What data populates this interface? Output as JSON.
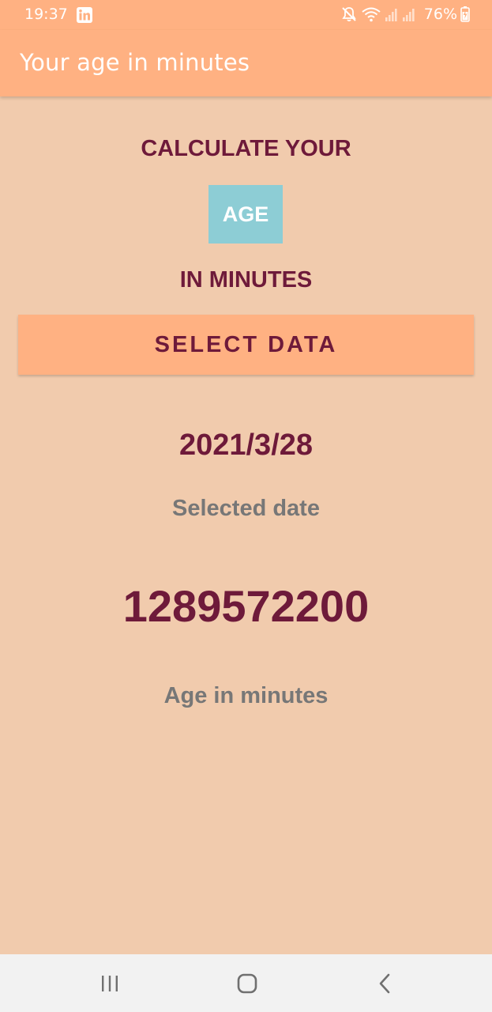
{
  "status_bar": {
    "time": "19:37",
    "battery": "76%"
  },
  "app_bar": {
    "title": "Your age in minutes"
  },
  "main": {
    "heading_top": "CALCULATE YOUR",
    "age_label": "AGE",
    "heading_bottom": "IN MINUTES",
    "select_button": "SELECT DATA",
    "selected_date_value": "2021/3/28",
    "selected_date_label": "Selected date",
    "minutes_value": "1289572200",
    "minutes_label": "Age in minutes"
  },
  "colors": {
    "accent": "#FFB182",
    "background": "#F1CBAD",
    "text_primary": "#6E1A3A",
    "text_secondary": "#777777",
    "age_box": "#8DCDD5",
    "nav_bar": "#F2F2F2"
  },
  "icons": {
    "status": [
      "linkedin-icon",
      "mute-icon",
      "wifi-icon",
      "signal-icon",
      "battery-charging-icon"
    ],
    "nav": [
      "recent-apps-icon",
      "home-icon",
      "back-icon"
    ]
  }
}
